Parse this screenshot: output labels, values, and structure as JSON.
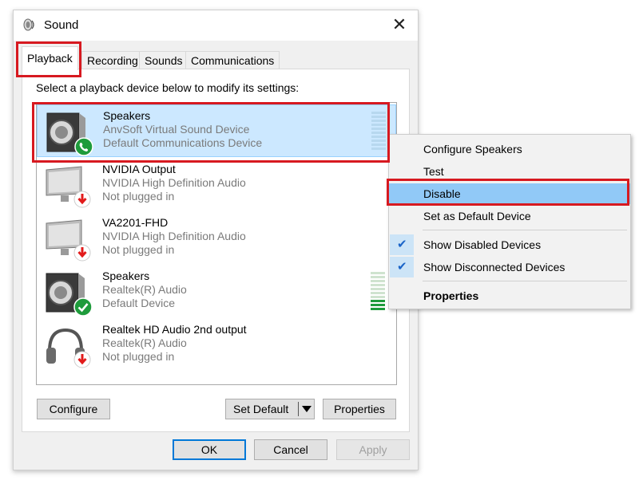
{
  "window": {
    "title": "Sound",
    "close_symbol": "✕"
  },
  "tabs": [
    {
      "label": "Playback"
    },
    {
      "label": "Recording"
    },
    {
      "label": "Sounds"
    },
    {
      "label": "Communications"
    }
  ],
  "instruction": "Select a playback device below to modify its settings:",
  "devices": [
    {
      "name": "Speakers",
      "description": "AnvSoft Virtual Sound Device",
      "status": "Default Communications Device",
      "icon": "speaker-icon",
      "badge": "phone-badge-icon",
      "selected": true,
      "level_meter": 0
    },
    {
      "name": "NVIDIA Output",
      "description": "NVIDIA High Definition Audio",
      "status": "Not plugged in",
      "icon": "monitor-icon",
      "badge": "unplugged-badge-icon"
    },
    {
      "name": "VA2201-FHD",
      "description": "NVIDIA High Definition Audio",
      "status": "Not plugged in",
      "icon": "monitor-icon",
      "badge": "unplugged-badge-icon"
    },
    {
      "name": "Speakers",
      "description": "Realtek(R) Audio",
      "status": "Default Device",
      "icon": "speaker-icon",
      "badge": "default-check-badge-icon",
      "level_meter": 0.3
    },
    {
      "name": "Realtek HD Audio 2nd output",
      "description": "Realtek(R) Audio",
      "status": "Not plugged in",
      "icon": "headphones-icon",
      "badge": "unplugged-badge-icon"
    }
  ],
  "buttons": {
    "configure": "Configure",
    "set_default": "Set Default",
    "properties": "Properties",
    "ok": "OK",
    "cancel": "Cancel",
    "apply": "Apply"
  },
  "context_menu": {
    "items": [
      {
        "label": "Configure Speakers"
      },
      {
        "label": "Test"
      },
      {
        "label": "Disable",
        "highlighted": true
      },
      {
        "label": "Set as Default Device"
      },
      {
        "label": "Show Disabled Devices",
        "checked": true
      },
      {
        "label": "Show Disconnected Devices",
        "checked": true
      },
      {
        "label": "Properties",
        "bold": true
      }
    ]
  },
  "colors": {
    "annotation_red": "#d71920",
    "selection_blue": "#cce8ff",
    "menu_highlight": "#91c9f7",
    "meter_green": "#1e9b3b",
    "badge_green": "#1e9b3b",
    "badge_red": "#e21b1b"
  }
}
